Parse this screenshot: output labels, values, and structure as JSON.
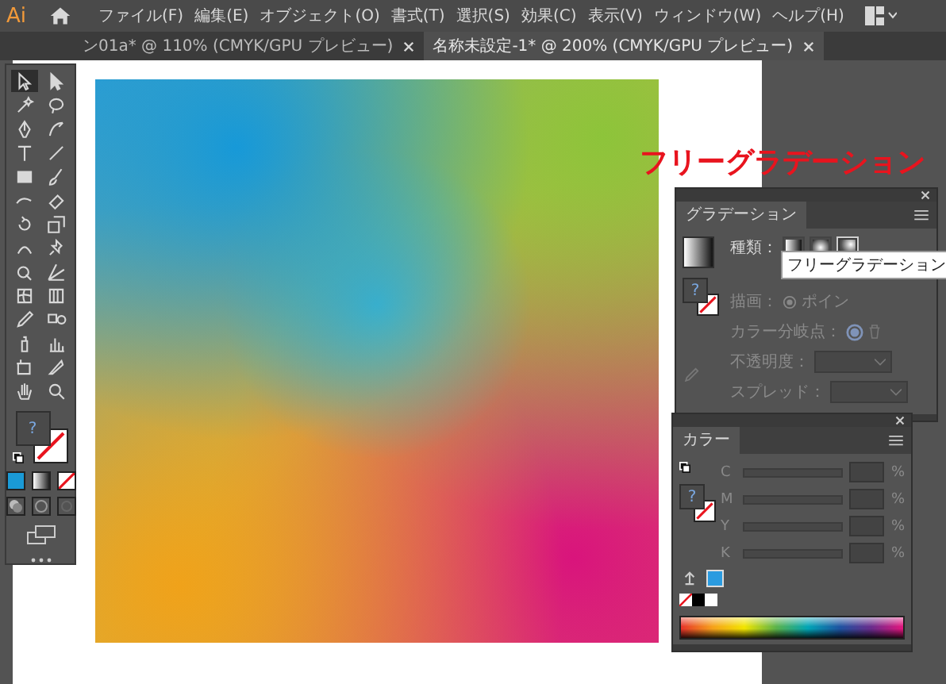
{
  "menu_bar": {
    "logo": "Ai",
    "items": [
      "ファイル(F)",
      "編集(E)",
      "オブジェクト(O)",
      "書式(T)",
      "選択(S)",
      "効果(C)",
      "表示(V)",
      "ウィンドウ(W)",
      "ヘルプ(H)"
    ]
  },
  "document_tabs": [
    {
      "label": "ン01a* @ 110% (CMYK/GPU プレビュー)",
      "selected": false
    },
    {
      "label": "名称未設定-1* @ 200% (CMYK/GPU プレビュー)",
      "selected": true
    }
  ],
  "toolbar": {
    "tools": [
      {
        "selected": true
      },
      {
        "selected": false
      },
      {
        "selected": false
      },
      {
        "selected": false
      },
      {
        "selected": false
      },
      {
        "selected": false
      },
      {
        "selected": false
      },
      {
        "selected": false
      },
      {
        "selected": false
      },
      {
        "selected": false
      },
      {
        "selected": false
      },
      {
        "selected": false
      },
      {
        "selected": false
      },
      {
        "selected": false
      },
      {
        "selected": false
      },
      {
        "selected": false
      },
      {
        "selected": false
      },
      {
        "selected": false
      },
      {
        "selected": false
      },
      {
        "selected": false
      },
      {
        "selected": false
      },
      {
        "selected": false
      },
      {
        "selected": false
      },
      {
        "selected": false
      },
      {
        "selected": false
      },
      {
        "selected": false
      },
      {
        "selected": false
      },
      {
        "selected": false
      }
    ],
    "fill_mark": "?"
  },
  "annotation": "フリーグラデーション",
  "gradient_panel": {
    "title": "グラデーション",
    "fill_mark": "?",
    "type_label": "種類：",
    "type_buttons": [
      {
        "selected": false
      },
      {
        "selected": false
      },
      {
        "selected": true
      }
    ],
    "tooltip": "フリーグラデーション",
    "draw_label": "描画：",
    "draw_value": "ポイン",
    "color_stop_label": "カラー分岐点：",
    "opacity_label": "不透明度：",
    "spread_label": "スプレッド："
  },
  "color_panel": {
    "title": "カラー",
    "fill_mark": "?",
    "channels": [
      {
        "label": "C",
        "unit": "%"
      },
      {
        "label": "M",
        "unit": "%"
      },
      {
        "label": "Y",
        "unit": "%"
      },
      {
        "label": "K",
        "unit": "%"
      }
    ]
  }
}
